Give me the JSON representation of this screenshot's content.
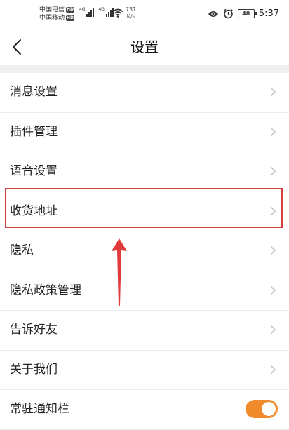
{
  "status_bar": {
    "carrier_1": "中国电信",
    "carrier_2": "中国移动",
    "hd_badge": "HD",
    "signal_1_label": "4G",
    "signal_2_label": "4G",
    "net_speed_value": "731",
    "net_speed_unit": "K/s",
    "battery_level": "48",
    "time": "5:37"
  },
  "app_bar": {
    "title": "设置",
    "back_icon": "chevron-left-icon"
  },
  "settings_items": [
    {
      "label": "消息设置"
    },
    {
      "label": "插件管理"
    },
    {
      "label": "语音设置"
    },
    {
      "label": "收货地址"
    },
    {
      "label": "隐私"
    },
    {
      "label": "隐私政策管理"
    },
    {
      "label": "告诉好友"
    },
    {
      "label": "关于我们"
    },
    {
      "label": "常驻通知栏"
    }
  ],
  "notification_toggle_on": true,
  "annotation": {
    "highlight_color": "#d5403d",
    "arrow_color": "#e03a3a"
  },
  "colors": {
    "toggle_on": "#f08a2b",
    "section_band": "#efefef"
  }
}
